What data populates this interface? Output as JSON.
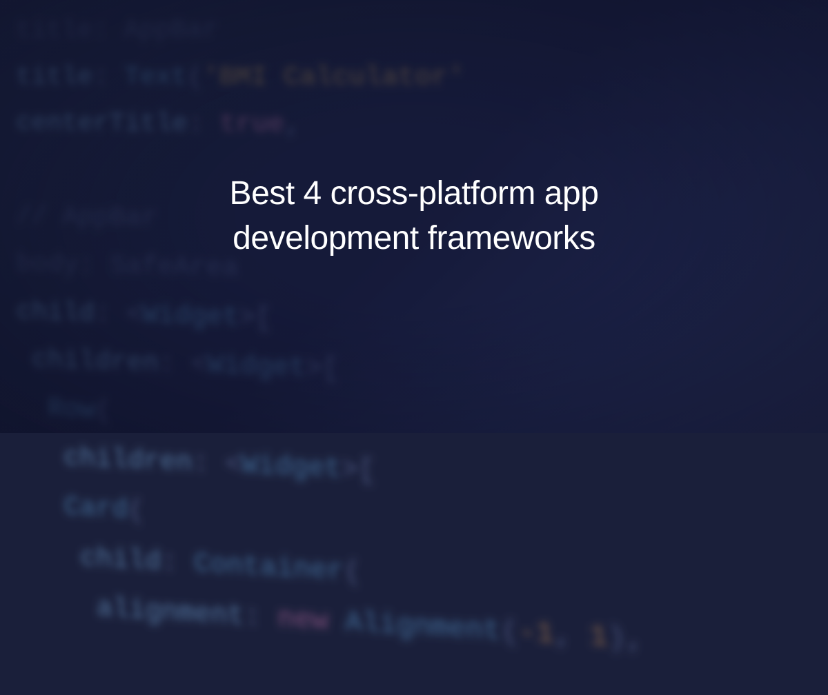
{
  "headline": {
    "line1": "Best 4 cross-platform app",
    "line2": "development frameworks"
  },
  "code_background": {
    "lines": [
      {
        "tokens": [
          {
            "text": "title",
            "cls": "kw-dim"
          },
          {
            "text": ": AppBar",
            "cls": "kw-dim"
          }
        ]
      },
      {
        "tokens": [
          {
            "text": "title",
            "cls": "kw-prop"
          },
          {
            "text": ": ",
            "cls": ""
          },
          {
            "text": "Text",
            "cls": "kw-type"
          },
          {
            "text": "(",
            "cls": ""
          },
          {
            "text": "'BMI Calculator'",
            "cls": "kw-str"
          }
        ]
      },
      {
        "tokens": [
          {
            "text": "centerTitle",
            "cls": "kw-prop"
          },
          {
            "text": ": ",
            "cls": ""
          },
          {
            "text": "true",
            "cls": "kw-bool"
          },
          {
            "text": ",",
            "cls": ""
          }
        ]
      },
      {
        "tokens": [
          {
            "text": "",
            "cls": ""
          }
        ]
      },
      {
        "tokens": [
          {
            "text": "// AppBar",
            "cls": "kw-dim"
          }
        ]
      },
      {
        "tokens": [
          {
            "text": "body",
            "cls": "kw-dim"
          },
          {
            "text": ": ",
            "cls": "kw-dim"
          },
          {
            "text": "SafeArea",
            "cls": "kw-dim"
          }
        ]
      },
      {
        "tokens": [
          {
            "text": "child",
            "cls": "kw-prop"
          },
          {
            "text": ": <",
            "cls": ""
          },
          {
            "text": "Widget",
            "cls": "kw-type"
          },
          {
            "text": ">[",
            "cls": ""
          }
        ]
      },
      {
        "tokens": [
          {
            "text": " children",
            "cls": "kw-prop"
          },
          {
            "text": ": <",
            "cls": ""
          },
          {
            "text": "Widget",
            "cls": "kw-type"
          },
          {
            "text": ">[",
            "cls": ""
          }
        ]
      },
      {
        "tokens": [
          {
            "text": "  Row",
            "cls": "kw-type"
          },
          {
            "text": "(",
            "cls": ""
          }
        ]
      },
      {
        "tokens": [
          {
            "text": "   children",
            "cls": "kw-prop"
          },
          {
            "text": ": <",
            "cls": ""
          },
          {
            "text": "Widget",
            "cls": "kw-type"
          },
          {
            "text": ">[",
            "cls": ""
          }
        ]
      },
      {
        "tokens": [
          {
            "text": "   Card",
            "cls": "kw-type"
          },
          {
            "text": "(",
            "cls": ""
          }
        ]
      },
      {
        "tokens": [
          {
            "text": "    child",
            "cls": "kw-prop"
          },
          {
            "text": ": ",
            "cls": ""
          },
          {
            "text": "Container",
            "cls": "kw-type"
          },
          {
            "text": "(",
            "cls": ""
          }
        ]
      },
      {
        "tokens": [
          {
            "text": "     alignment",
            "cls": "kw-prop"
          },
          {
            "text": ": ",
            "cls": ""
          },
          {
            "text": "new",
            "cls": "kw-new"
          },
          {
            "text": " Alignment",
            "cls": "kw-type"
          },
          {
            "text": "(",
            "cls": ""
          },
          {
            "text": "-1",
            "cls": "kw-num"
          },
          {
            "text": ", ",
            "cls": ""
          },
          {
            "text": "1",
            "cls": "kw-num"
          },
          {
            "text": "),",
            "cls": ""
          }
        ]
      }
    ]
  }
}
